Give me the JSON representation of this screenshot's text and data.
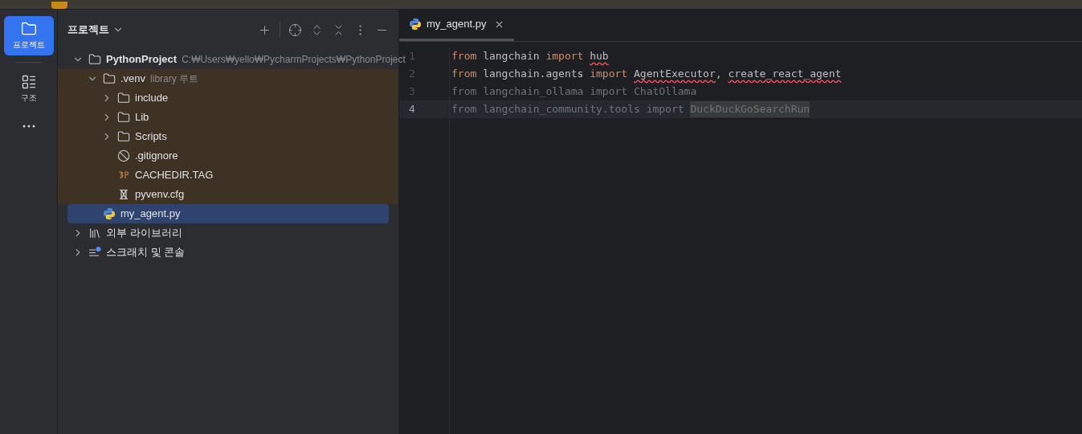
{
  "toolwindow_stripe": [
    {
      "kind": "project",
      "label": "프로젝트",
      "selected": true
    },
    {
      "kind": "structure",
      "label": "구조",
      "selected": false
    },
    {
      "kind": "more",
      "selected": false
    }
  ],
  "project_panel": {
    "title": "프로젝트",
    "tree": [
      {
        "kind": "folder",
        "name": "PythonProject",
        "bold": true,
        "hint": "C:₩Users₩yello₩PycharmProjects₩PythonProject",
        "expanded": true,
        "selected": false,
        "children": [
          {
            "kind": "folder",
            "name": ".venv",
            "hint": "library 루트",
            "library": true,
            "expanded": true,
            "selected": false,
            "children": [
              {
                "kind": "folder",
                "name": "include",
                "expanded": false,
                "selected": false
              },
              {
                "kind": "folder",
                "name": "Lib",
                "expanded": false,
                "selected": false
              },
              {
                "kind": "folder",
                "name": "Scripts",
                "expanded": false,
                "selected": false
              },
              {
                "kind": "ignore",
                "name": ".gitignore",
                "selected": false
              },
              {
                "kind": "tag",
                "name": "CACHEDIR.TAG",
                "selected": false
              },
              {
                "kind": "cfg",
                "name": "pyvenv.cfg",
                "selected": false
              }
            ]
          },
          {
            "kind": "python",
            "name": "my_agent.py",
            "selected": true
          }
        ]
      },
      {
        "kind": "library",
        "name": "외부 라이브러리",
        "expanded": false,
        "selected": false
      },
      {
        "kind": "scratch",
        "name": "스크래치 및 콘솔",
        "expanded": false,
        "selected": false
      }
    ]
  },
  "editor": {
    "tabs": [
      {
        "name": "my_agent.py",
        "selected": true
      }
    ],
    "lines": [
      {
        "number": "1",
        "current": false,
        "tokens": [
          {
            "text": "from",
            "kind": "keyword"
          },
          {
            "text": " langchain ",
            "kind": "plain"
          },
          {
            "text": "import ",
            "kind": "keyword"
          },
          {
            "text": "hub",
            "kind": "unresolved"
          }
        ]
      },
      {
        "number": "2",
        "current": false,
        "tokens": [
          {
            "text": "from",
            "kind": "keyword"
          },
          {
            "text": " langchain.agents ",
            "kind": "plain"
          },
          {
            "text": "import ",
            "kind": "keyword"
          },
          {
            "text": "AgentExecutor",
            "kind": "unresolved"
          },
          {
            "text": ", ",
            "kind": "plain"
          },
          {
            "text": "create_react_agent",
            "kind": "unresolved"
          }
        ]
      },
      {
        "number": "3",
        "current": false,
        "tokens": [
          {
            "text": "from langchain_ollama import ChatOllama",
            "kind": "unused"
          }
        ]
      },
      {
        "number": "4",
        "current": true,
        "tokens": [
          {
            "text": "from langchain_community.tools import ",
            "kind": "unused"
          },
          {
            "text": "DuckDuckGoSearchRun",
            "kind": "unused_highlight"
          }
        ]
      }
    ]
  }
}
